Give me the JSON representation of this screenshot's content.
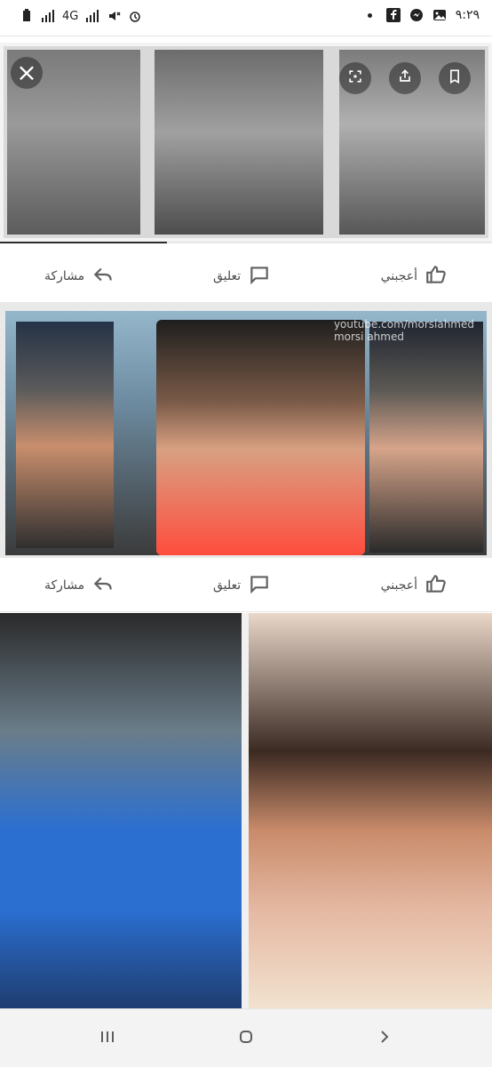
{
  "status_bar": {
    "left_network_1": "4G",
    "right_time": "٩:٢٩"
  },
  "viewer": {
    "close_label": "×",
    "progress_fraction": 0.34
  },
  "actions": {
    "like": "أعجبني",
    "comment": "تعليق",
    "share": "مشاركة"
  },
  "watermark": {
    "line1": "youtube.com/morsiahmed",
    "line2": "morsi ahmed"
  },
  "colors": {
    "icon": "#606060",
    "text": "#4a4a4a",
    "divider": "#e7e7e7"
  },
  "nav": {
    "recent_icon": "recent-apps-icon",
    "home_icon": "home-icon",
    "back_icon": "back-icon"
  }
}
